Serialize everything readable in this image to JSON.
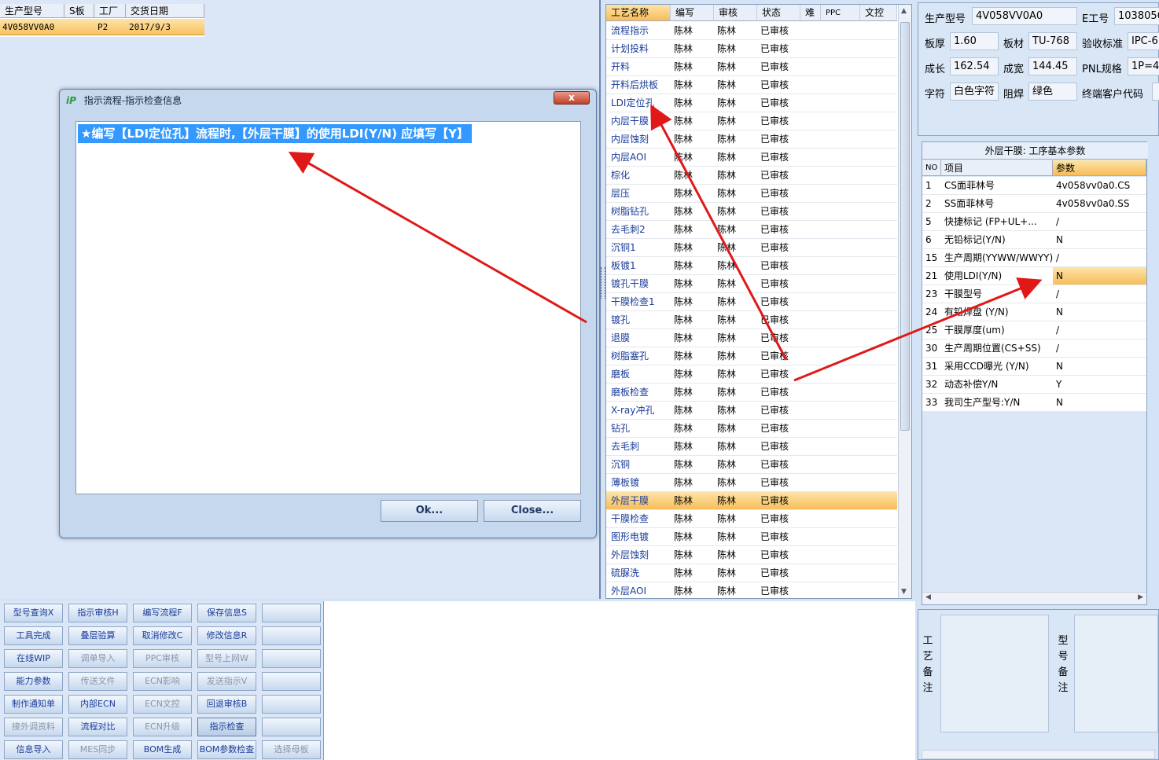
{
  "left_grid": {
    "headers": [
      "生产型号",
      "S板",
      "工厂",
      "交货日期"
    ],
    "row": [
      "4V058VV0A0",
      "",
      "P2",
      "2017/9/3"
    ]
  },
  "dialog": {
    "title": "指示流程-指示检查信息",
    "close_label": "x",
    "message": "★编写【LDI定位孔】流程时,【外层干膜】的使用LDI(Y/N) 应填写【Y】",
    "ok_label": "Ok...",
    "close_button_label": "Close..."
  },
  "process_grid": {
    "headers": [
      "工艺名称",
      "编写",
      "审核",
      "状态",
      "难",
      "PPC",
      "文控"
    ],
    "rows": [
      [
        "流程指示",
        "陈林",
        "陈林",
        "已审核"
      ],
      [
        "计划投料",
        "陈林",
        "陈林",
        "已审核"
      ],
      [
        "开料",
        "陈林",
        "陈林",
        "已审核"
      ],
      [
        "开料后烘板",
        "陈林",
        "陈林",
        "已审核"
      ],
      [
        "LDI定位孔",
        "陈林",
        "陈林",
        "已审核"
      ],
      [
        "内层干膜",
        "陈林",
        "陈林",
        "已审核"
      ],
      [
        "内层蚀刻",
        "陈林",
        "陈林",
        "已审核"
      ],
      [
        "内层AOI",
        "陈林",
        "陈林",
        "已审核"
      ],
      [
        "棕化",
        "陈林",
        "陈林",
        "已审核"
      ],
      [
        "层压",
        "陈林",
        "陈林",
        "已审核"
      ],
      [
        "树脂钻孔",
        "陈林",
        "陈林",
        "已审核"
      ],
      [
        "去毛刺2",
        "陈林",
        "陈林",
        "已审核"
      ],
      [
        "沉铜1",
        "陈林",
        "陈林",
        "已审核"
      ],
      [
        "板镀1",
        "陈林",
        "陈林",
        "已审核"
      ],
      [
        "镀孔干膜",
        "陈林",
        "陈林",
        "已审核"
      ],
      [
        "干膜检查1",
        "陈林",
        "陈林",
        "已审核"
      ],
      [
        "镀孔",
        "陈林",
        "陈林",
        "已审核"
      ],
      [
        "退膜",
        "陈林",
        "陈林",
        "已审核"
      ],
      [
        "树脂塞孔",
        "陈林",
        "陈林",
        "已审核"
      ],
      [
        "磨板",
        "陈林",
        "陈林",
        "已审核"
      ],
      [
        "磨板检查",
        "陈林",
        "陈林",
        "已审核"
      ],
      [
        "X-ray冲孔",
        "陈林",
        "陈林",
        "已审核"
      ],
      [
        "钻孔",
        "陈林",
        "陈林",
        "已审核"
      ],
      [
        "去毛刺",
        "陈林",
        "陈林",
        "已审核"
      ],
      [
        "沉铜",
        "陈林",
        "陈林",
        "已审核"
      ],
      [
        "薄板镀",
        "陈林",
        "陈林",
        "已审核"
      ],
      [
        "外层干膜",
        "陈林",
        "陈林",
        "已审核"
      ],
      [
        "干膜检查",
        "陈林",
        "陈林",
        "已审核"
      ],
      [
        "图形电镀",
        "陈林",
        "陈林",
        "已审核"
      ],
      [
        "外层蚀刻",
        "陈林",
        "陈林",
        "已审核"
      ],
      [
        "硫脲洗",
        "陈林",
        "陈林",
        "已审核"
      ],
      [
        "外层AOI",
        "陈林",
        "陈林",
        "已审核"
      ]
    ],
    "selected_index": 26
  },
  "info": {
    "model_label": "生产型号",
    "model_value": "4V058VV0A0",
    "e_label": "E工号",
    "e_value": "1038056",
    "thick_label": "板厚",
    "thick_value": "1.60",
    "mat_label": "板材",
    "mat_value": "TU-768",
    "std_label": "验收标准",
    "std_value": "IPC-6",
    "len_label": "成长",
    "len_value": "162.54",
    "wid_label": "成宽",
    "wid_value": "144.45",
    "pnl_label": "PNL规格",
    "pnl_value": "1P=4",
    "char_label": "字符",
    "char_value": "白色字符",
    "mask_label": "阻焊",
    "mask_value": "绿色",
    "cust_label": "终端客户代码",
    "cust_value": ""
  },
  "params": {
    "caption": "外层干膜: 工序基本参数",
    "headers": [
      "NO",
      "项目",
      "参数"
    ],
    "rows": [
      [
        "1",
        "CS面菲林号",
        "4v058vv0a0.CS"
      ],
      [
        "2",
        "SS面菲林号",
        "4v058vv0a0.SS"
      ],
      [
        "5",
        "快捷标记 (FP+UL+...",
        "/"
      ],
      [
        "6",
        "无铅标记(Y/N)",
        "N"
      ],
      [
        "15",
        "生产周期(YYWW/WWYY)",
        "/"
      ],
      [
        "21",
        "使用LDI(Y/N)",
        "N"
      ],
      [
        "23",
        "干膜型号",
        "/"
      ],
      [
        "24",
        "有铅焊盘 (Y/N)",
        "N"
      ],
      [
        "25",
        "干膜厚度(um)",
        "/"
      ],
      [
        "30",
        "生产周期位置(CS+SS)",
        "/"
      ],
      [
        "31",
        "采用CCD曝光 (Y/N)",
        "N"
      ],
      [
        "32",
        "动态补偿Y/N",
        "Y"
      ],
      [
        "33",
        "我司生产型号:Y/N",
        "N"
      ]
    ],
    "highlight_index": 5
  },
  "buttons": [
    [
      "型号查询X",
      "指示审核H",
      "编写流程F",
      "保存信息S",
      ""
    ],
    [
      "工具完成",
      "叠层验算",
      "取消修改C",
      "修改信息R",
      ""
    ],
    [
      "在线WIP",
      "调单导入",
      "PPC审核",
      "型号上网W",
      ""
    ],
    [
      "能力参数",
      "传送文件",
      "ECN影响",
      "发送指示V",
      ""
    ],
    [
      "制作通知单",
      "内部ECN",
      "ECN文控",
      "回退审核B",
      ""
    ],
    [
      "接外调资料",
      "流程对比",
      "ECN升级",
      "指示检查",
      ""
    ],
    [
      "信息导入",
      "MES同步",
      "BOM生成",
      "BOM参数检查",
      "选择母板"
    ]
  ],
  "remark": {
    "process_label": "工艺备注",
    "model_label": "型号备注"
  },
  "colors": {
    "arrow": "#e01818",
    "selection": "#f7bd5a",
    "highlight_text": "#3399ff"
  }
}
